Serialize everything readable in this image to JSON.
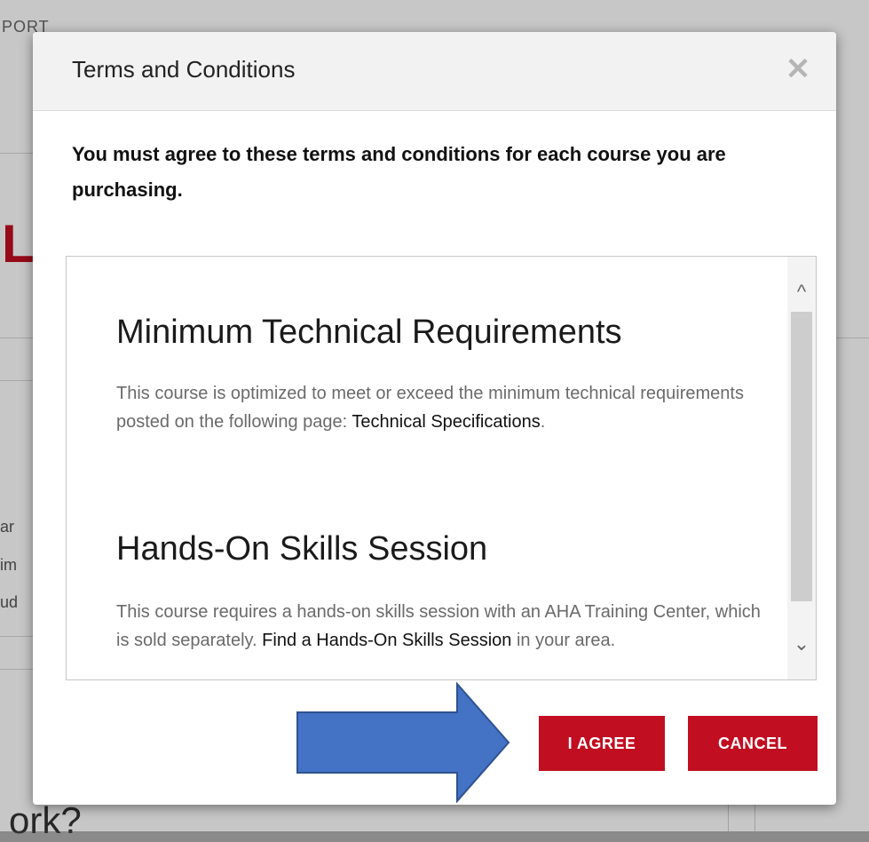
{
  "background": {
    "support_label": "PORT",
    "red_fragment": "LS",
    "side_fragments": [
      "ar",
      "im",
      "ud"
    ],
    "bottom_fragment": "ork?"
  },
  "modal": {
    "title": "Terms and Conditions",
    "close_icon": "close-icon",
    "intro": "You must agree to these terms and conditions for each course you are purchasing.",
    "sections": [
      {
        "title": "Minimum Technical Requirements",
        "body_prefix": "This course is optimized to meet or exceed the minimum technical requirements posted on the following page: ",
        "link": "Technical Specifications",
        "body_suffix": "."
      },
      {
        "title": "Hands-On Skills Session",
        "body_prefix": "This course requires a hands-on skills session with an AHA Training Center, which is sold separately. ",
        "link": "Find a Hands-On Skills Session",
        "body_suffix": " in your area."
      }
    ],
    "buttons": {
      "agree": "I AGREE",
      "cancel": "CANCEL"
    }
  },
  "colors": {
    "brand_red": "#c10e21",
    "arrow_blue": "#4472c4"
  }
}
